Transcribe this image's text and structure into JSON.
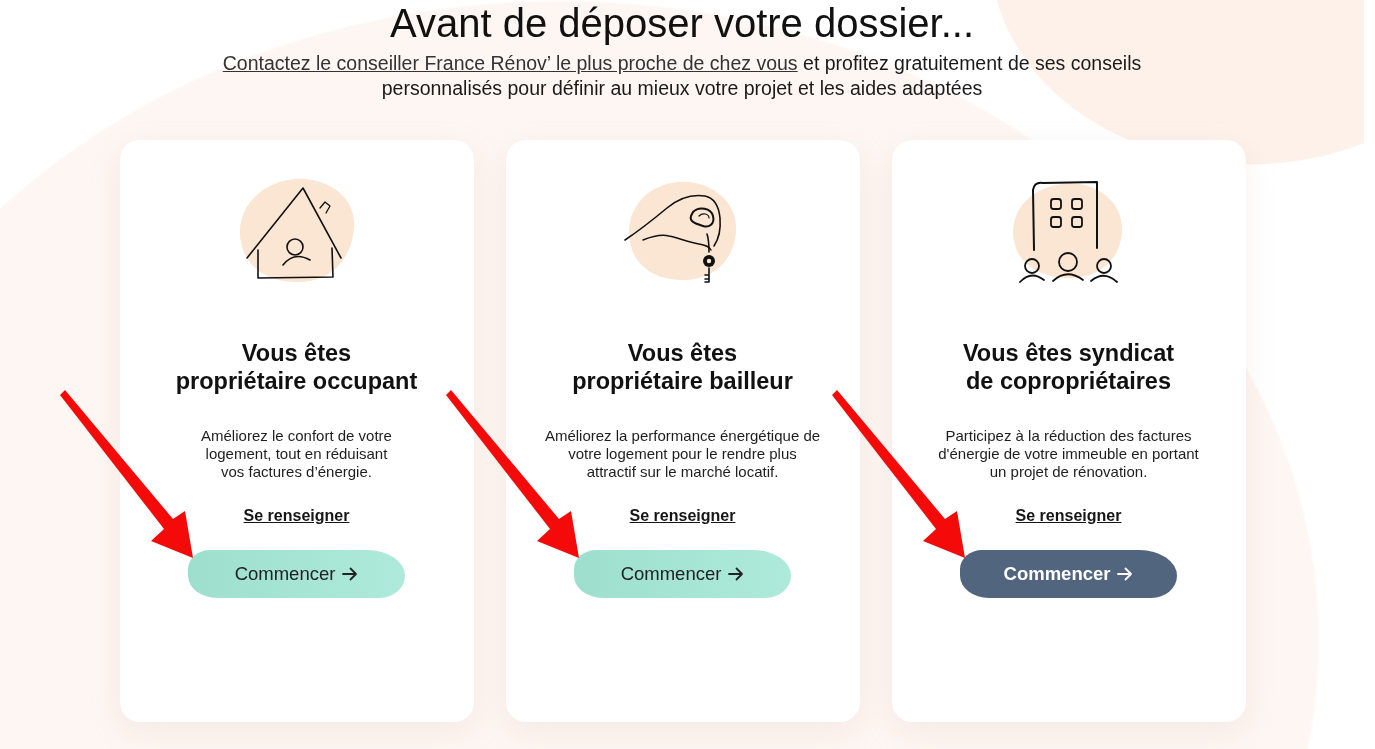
{
  "heading": "Avant de déposer votre dossier...",
  "intro": {
    "link": "Contactez le conseiller France Rénov’ le plus proche de chez vous",
    "text": "et profitez gratuitement de ses conseils personnalisés pour définir au mieux votre projet et les aides adaptées"
  },
  "cards": [
    {
      "kind": "owner",
      "title": "Vous êtes\npropriétaire occupant",
      "description": "Améliorez le confort de votre\nlogement, tout en réduisant\nvos factures d’énergie.",
      "link": "Se renseigner",
      "button": {
        "label": "Commencer",
        "hovered": false
      },
      "pointed_at": true
    },
    {
      "kind": "landlord",
      "title": "Vous êtes\npropriétaire bailleur",
      "description": "Améliorez la performance énergétique de\nvotre logement pour le rendre plus\nattractif sur le marché locatif.",
      "link": "Se renseigner",
      "button": {
        "label": "Commencer",
        "hovered": false
      },
      "pointed_at": true
    },
    {
      "kind": "association",
      "title": "Vous êtes syndicat\nde copropriétaires",
      "description": "Participez à la réduction des factures\nd'énergie de votre immeuble en portant\nun projet de rénovation.",
      "link": "Se renseigner",
      "button": {
        "label": "Commencer",
        "hovered": true
      },
      "pointed_at": true
    }
  ]
}
